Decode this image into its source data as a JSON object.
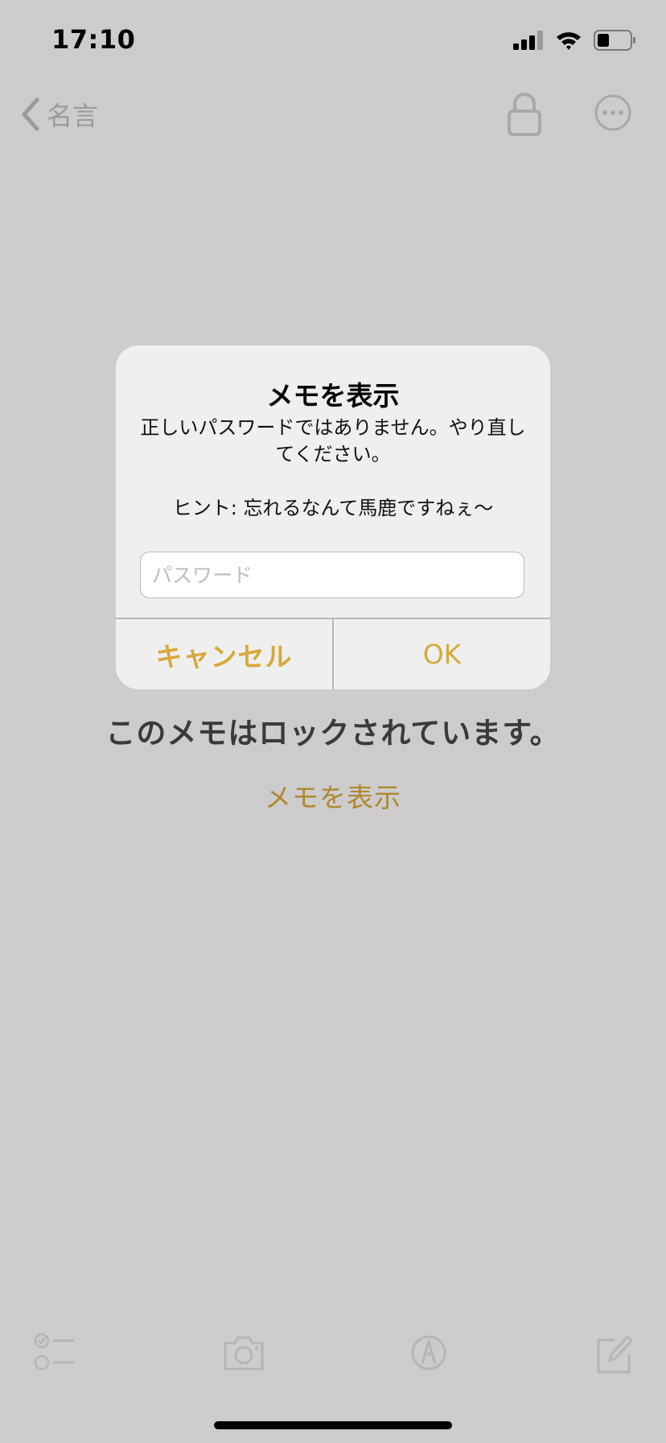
{
  "status_bar": {
    "time": "17:10"
  },
  "nav": {
    "back_label": "名言"
  },
  "alert": {
    "title": "メモを表示",
    "message": "正しいパスワードではありません。やり直してください。",
    "hint": "ヒント: 忘れるなんて馬鹿ですねぇ〜",
    "password_placeholder": "パスワード",
    "password_value": "",
    "cancel_label": "キャンセル",
    "ok_label": "OK"
  },
  "locked": {
    "message": "このメモはロックされています。",
    "show_link": "メモを表示"
  },
  "icons": {
    "back": "chevron-left-icon",
    "lock": "lock-icon",
    "more": "ellipsis-circle-icon",
    "checklist": "checklist-icon",
    "camera": "camera-icon",
    "markup": "pen-tip-icon",
    "compose": "compose-icon"
  },
  "colors": {
    "background": "#cccccc",
    "accent": "#d8a83a",
    "accent_dim": "#b0882f",
    "icon_dim": "#a8a8a8"
  }
}
